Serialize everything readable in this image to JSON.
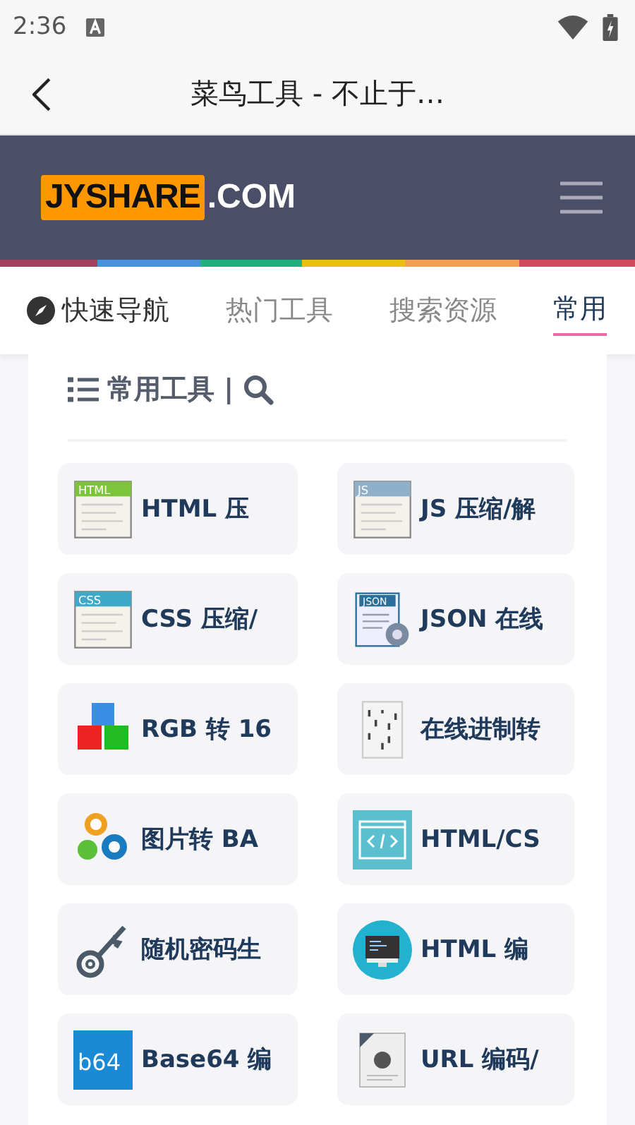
{
  "status_bar": {
    "time": "2:36"
  },
  "app_bar": {
    "title": "菜鸟工具 - 不止于…"
  },
  "site_header": {
    "logo_main": "JYSHARE",
    "logo_suffix": ".COM"
  },
  "tabs": [
    {
      "label": "快速导航",
      "kind": "compass",
      "selected": false
    },
    {
      "label": "热门工具",
      "kind": "plain",
      "selected": false
    },
    {
      "label": "搜索资源",
      "kind": "plain",
      "selected": false
    },
    {
      "label": "常用",
      "kind": "plain",
      "selected": true
    }
  ],
  "section": {
    "title": "常用工具 |"
  },
  "tools": [
    {
      "label": "HTML 压",
      "kind": "doc",
      "icon_text": "HTML",
      "color": "#7cc43a"
    },
    {
      "label": "JS 压缩/解",
      "kind": "doc",
      "icon_text": "JS",
      "color": "#8fb0c8"
    },
    {
      "label": "CSS 压缩/",
      "kind": "doc",
      "icon_text": "CSS",
      "color": "#3fa9c9"
    },
    {
      "label": "JSON 在线",
      "kind": "json",
      "icon_text": "JSON",
      "color": "#2a6f9a"
    },
    {
      "label": "RGB 转 16",
      "kind": "cubes"
    },
    {
      "label": "在线进制转",
      "kind": "binary"
    },
    {
      "label": "图片转 BA",
      "kind": "gears"
    },
    {
      "label": "HTML/CS",
      "kind": "window"
    },
    {
      "label": "随机密码生",
      "kind": "key"
    },
    {
      "label": "HTML 编",
      "kind": "monitor"
    },
    {
      "label": "Base64 编",
      "kind": "b64",
      "icon_text": "b64",
      "color": "#1a8ad4"
    },
    {
      "label": "URL 编码/",
      "kind": "page"
    }
  ]
}
